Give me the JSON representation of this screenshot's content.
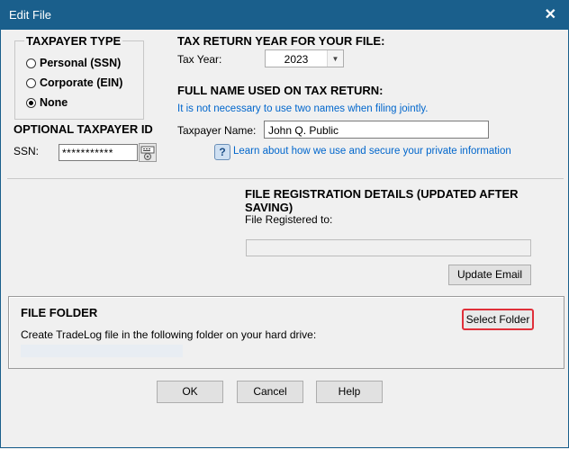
{
  "window": {
    "title": "Edit File",
    "close_glyph": "✕"
  },
  "taxpayer_type": {
    "heading": "TAXPAYER TYPE",
    "options": [
      {
        "label": "Personal (SSN)",
        "selected": false
      },
      {
        "label": "Corporate (EIN)",
        "selected": false
      },
      {
        "label": "None",
        "selected": true
      }
    ]
  },
  "optional_id": {
    "heading": "OPTIONAL TAXPAYER ID",
    "ssn_label": "SSN:",
    "ssn_value": "***********",
    "icon": "keyboard-icon"
  },
  "tax_year": {
    "heading": "TAX RETURN YEAR FOR YOUR FILE:",
    "label": "Tax Year:",
    "value": "2023"
  },
  "full_name": {
    "heading": "FULL NAME USED ON TAX RETURN:",
    "note": "It is not necessary to use two names when filing jointly.",
    "label": "Taxpayer Name:",
    "value": "John Q. Public",
    "help_link": "Learn about how we use and secure your private information",
    "help_icon": "question-icon"
  },
  "registration": {
    "heading": "FILE REGISTRATION DETAILS (UPDATED AFTER SAVING)",
    "label": "File Registered to:",
    "value": "",
    "update_button": "Update Email"
  },
  "file_folder": {
    "heading": "FILE FOLDER",
    "description": "Create TradeLog file in the following folder on your hard drive:",
    "path": "",
    "select_button": "Select Folder",
    "highlight_color": "#e0303a"
  },
  "buttons": {
    "ok": "OK",
    "cancel": "Cancel",
    "help": "Help"
  },
  "colors": {
    "titlebar": "#1a5f8c",
    "link": "#0066cc"
  }
}
